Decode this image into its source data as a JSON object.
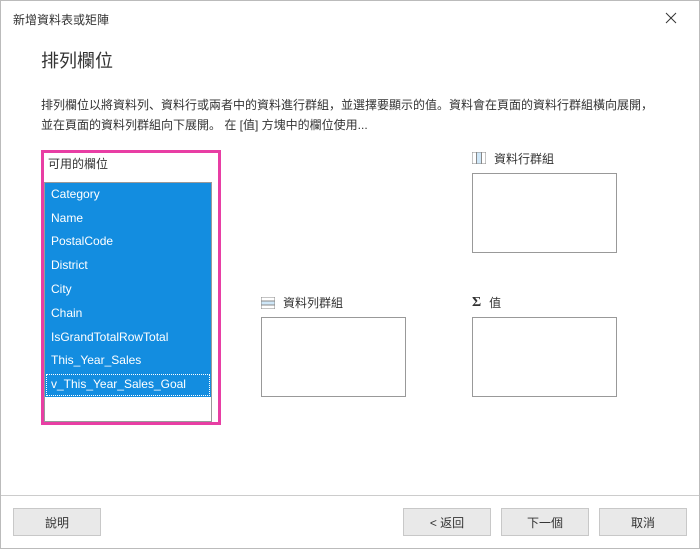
{
  "titlebar": {
    "title": "新增資料表或矩陣"
  },
  "heading": "排列欄位",
  "description": "排列欄位以將資料列、資料行或兩者中的資料進行群組，並選擇要顯示的值。資料會在頁面的資料行群組橫向展開，並在頁面的資料列群組向下展開。 在 [值] 方塊中的欄位使用...",
  "available": {
    "label": "可用的欄位",
    "items": [
      "Category",
      "Name",
      "PostalCode",
      "District",
      "City",
      "Chain",
      "IsGrandTotalRowTotal",
      "This_Year_Sales",
      "v_This_Year_Sales_Goal"
    ]
  },
  "colgroup": {
    "label": "資料行群組"
  },
  "rowgroup": {
    "label": "資料列群組"
  },
  "valuegroup": {
    "label": "值"
  },
  "footer": {
    "help": "說明",
    "back": "< 返回",
    "next": "下一個",
    "cancel": "取消"
  }
}
